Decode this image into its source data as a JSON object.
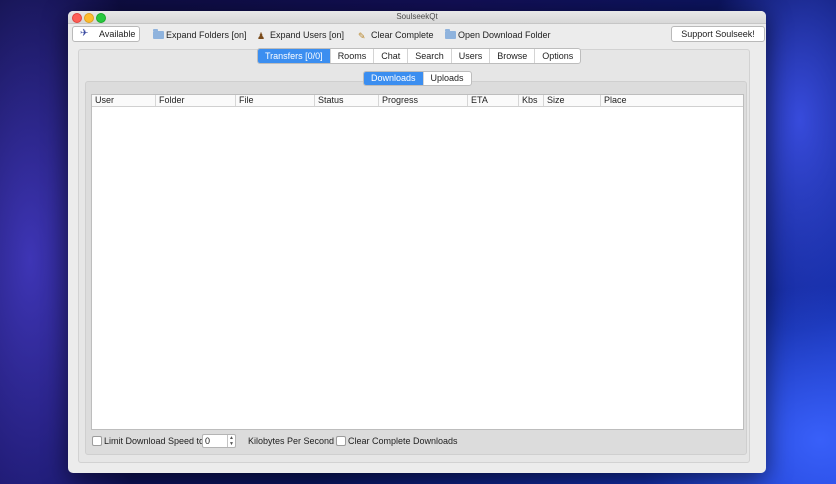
{
  "window": {
    "title": "SoulseekQt"
  },
  "toolbar": {
    "status_label": "Available",
    "expand_folders": "Expand Folders [on]",
    "expand_users": "Expand Users [on]",
    "clear_complete": "Clear Complete",
    "open_download_folder": "Open Download Folder",
    "support": "Support Soulseek!"
  },
  "main_tabs": [
    {
      "label": "Transfers [0/0]",
      "active": true
    },
    {
      "label": "Rooms"
    },
    {
      "label": "Chat"
    },
    {
      "label": "Search"
    },
    {
      "label": "Users"
    },
    {
      "label": "Browse"
    },
    {
      "label": "Options"
    }
  ],
  "sub_tabs": [
    {
      "label": "Downloads",
      "active": true
    },
    {
      "label": "Uploads"
    }
  ],
  "table": {
    "columns": [
      "User",
      "Folder",
      "File",
      "Status",
      "Progress",
      "ETA",
      "Kbs",
      "Size",
      "Place"
    ],
    "rows": []
  },
  "footer": {
    "limit_label": "Limit Download Speed to",
    "limit_value": "0",
    "unit_label": "Kilobytes Per Second",
    "clear_label": "Clear Complete Downloads"
  }
}
